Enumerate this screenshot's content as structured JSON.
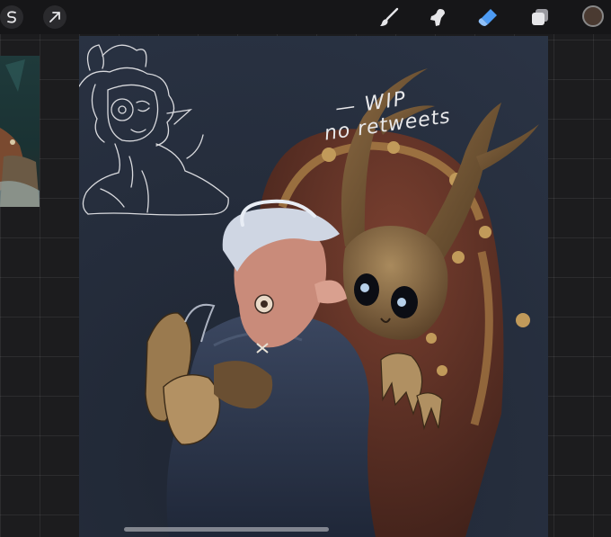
{
  "app": {
    "colors": {
      "toolbar_bg": "#161618",
      "workspace_bg": "#1c1c1e",
      "canvas_bg": "#262d3a",
      "active_tool": "#4d9bf3",
      "current_color": "#4a3a31"
    }
  },
  "toolbar": {
    "left_tools": [
      {
        "name": "selection",
        "icon": "selection-s-icon"
      },
      {
        "name": "transform",
        "icon": "transform-arrow-icon"
      }
    ],
    "right_tools": [
      {
        "name": "brush",
        "icon": "paint-brush-icon",
        "active": false
      },
      {
        "name": "smudge",
        "icon": "smudge-finger-icon",
        "active": false
      },
      {
        "name": "eraser",
        "icon": "eraser-icon",
        "active": true
      },
      {
        "name": "layers",
        "icon": "layers-icon",
        "active": false
      },
      {
        "name": "color",
        "icon": "color-swatch",
        "value": "#4a3a31"
      }
    ]
  },
  "canvas": {
    "annotation_lines": [
      "— WIP",
      "no retweets"
    ]
  }
}
